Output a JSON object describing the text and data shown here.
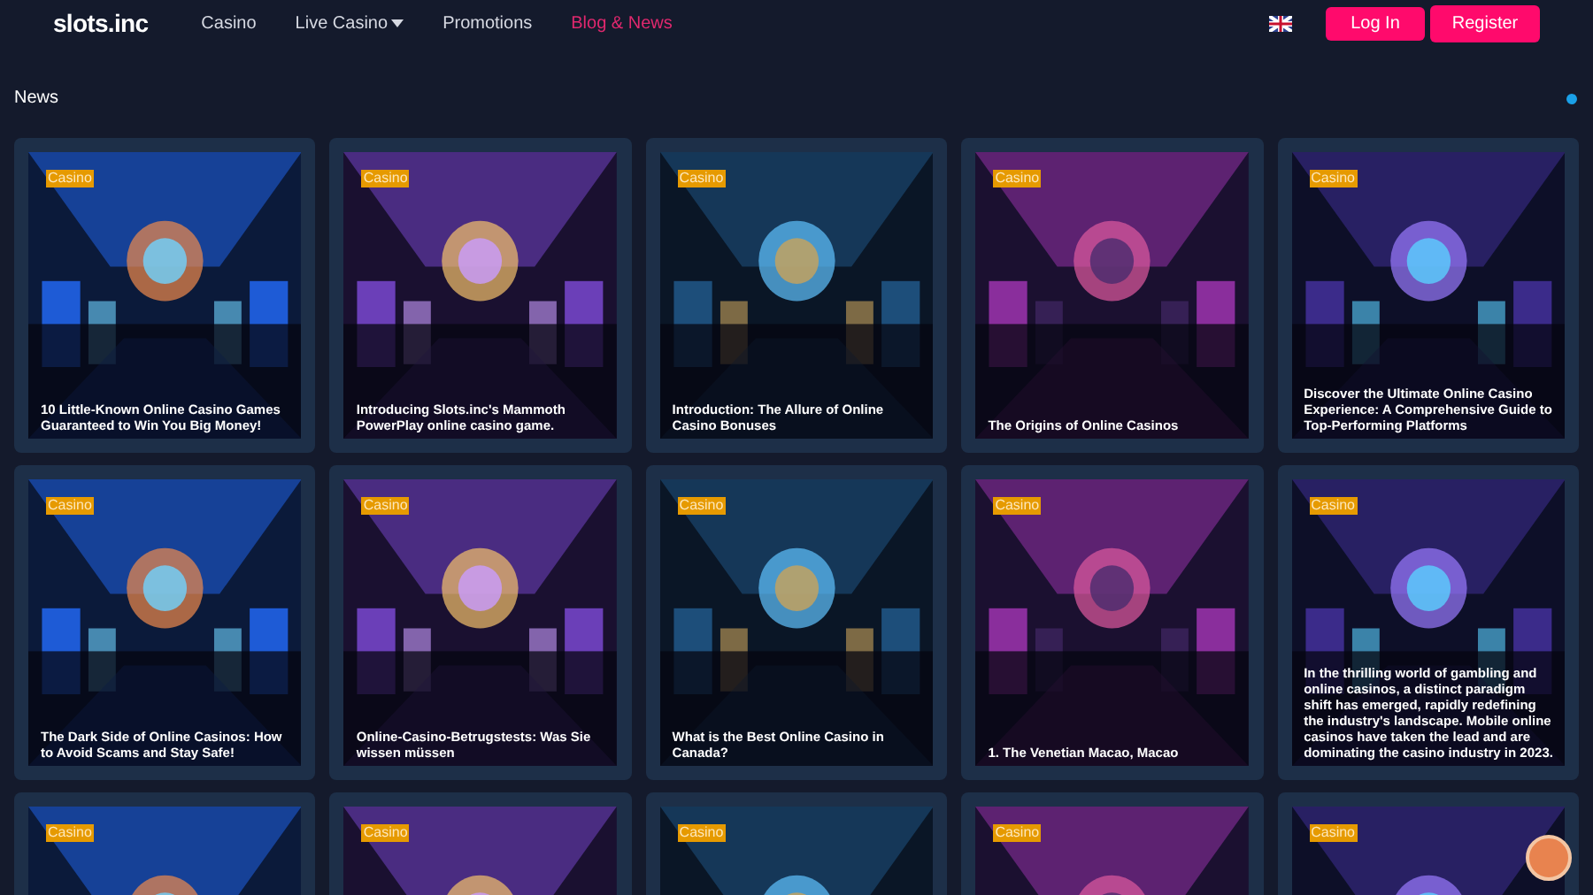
{
  "header": {
    "logo": "slots.inc",
    "nav": [
      {
        "label": "Casino",
        "selected": false,
        "dropdown": false
      },
      {
        "label": "Live Casino",
        "selected": false,
        "dropdown": true
      },
      {
        "label": "Promotions",
        "selected": false,
        "dropdown": false
      },
      {
        "label": "Blog & News",
        "selected": true,
        "dropdown": false
      }
    ],
    "login": "Log In",
    "register": "Register"
  },
  "section": {
    "title": "News"
  },
  "articles": [
    {
      "tag": "Casino",
      "title": "10 Little-Known Online Casino Games Guaranteed to Win You Big Money!"
    },
    {
      "tag": "Casino",
      "title": "Introducing Slots.inc's Mammoth PowerPlay online casino game."
    },
    {
      "tag": "Casino",
      "title": "Introduction: The Allure of Online Casino Bonuses"
    },
    {
      "tag": "Casino",
      "title": "The Origins of Online Casinos"
    },
    {
      "tag": "Casino",
      "title": "Discover the Ultimate Online Casino Experience: A Comprehensive Guide to Top-Performing Platforms"
    },
    {
      "tag": "Casino",
      "title": "The Dark Side of Online Casinos: How to Avoid Scams and Stay Safe!"
    },
    {
      "tag": "Casino",
      "title": "Online-Casino-Betrugstests: Was Sie wissen müssen"
    },
    {
      "tag": "Casino",
      "title": "What is the Best Online Casino in Canada?"
    },
    {
      "tag": "Casino",
      "title": "1. The Venetian Macao, Macao"
    },
    {
      "tag": "Casino",
      "title": "In the thrilling world of gambling and online casinos, a distinct paradigm shift has emerged, rapidly redefining the industry's landscape. Mobile online casinos have taken the lead and are dominating the casino industry in 2023."
    },
    {
      "tag": "Casino"
    },
    {
      "tag": "Casino"
    },
    {
      "tag": "Casino"
    },
    {
      "tag": "Casino"
    },
    {
      "tag": "Casino"
    }
  ]
}
